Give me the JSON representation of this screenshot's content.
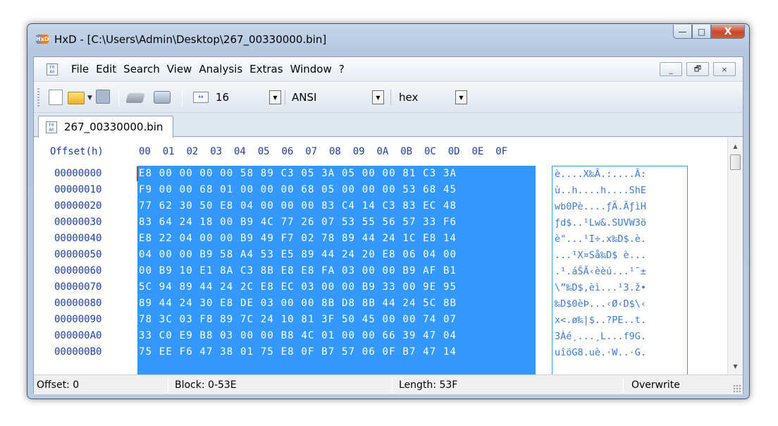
{
  "window": {
    "title": "HxD - [C:\\Users\\Admin\\Desktop\\267_00330000.bin]",
    "icon": "hxd-app-icon",
    "caption_buttons": {
      "minimize": "—",
      "maximize": "□",
      "close": "X"
    }
  },
  "menubar": {
    "items": [
      "File",
      "Edit",
      "Search",
      "View",
      "Analysis",
      "Extras",
      "Window",
      "?"
    ],
    "mdi_buttons": {
      "minimize": "_",
      "restore": "🗗",
      "close": "×"
    }
  },
  "toolbar": {
    "bytes_per_row": "16",
    "charset": "ANSI",
    "offset_base": "hex",
    "icons": [
      "new-file-icon",
      "open-file-icon",
      "save-icon",
      "open-disk-icon",
      "open-ram-icon",
      "bytes-per-row-icon"
    ]
  },
  "tab": {
    "label": "267_00330000.bin"
  },
  "editor": {
    "offset_header": "Offset(h)",
    "columns": [
      "00",
      "01",
      "02",
      "03",
      "04",
      "05",
      "06",
      "07",
      "08",
      "09",
      "0A",
      "0B",
      "0C",
      "0D",
      "0E",
      "0F"
    ],
    "rows": [
      {
        "offset": "00000000",
        "hex": "E8 00 00 00 00 58 89 C3 05 3A 05 00 00 81 C3 3A",
        "ascii": "è....X‰Ã.:....Ã:"
      },
      {
        "offset": "00000010",
        "hex": "F9 00 00 68 01 00 00 00 68 05 00 00 00 53 68 45",
        "ascii": "ù..h....h....ShE"
      },
      {
        "offset": "00000020",
        "hex": "77 62 30 50 E8 04 00 00 00 83 C4 14 C3 83 EC 48",
        "ascii": "wb0Pè....ƒÄ.ÃƒìH"
      },
      {
        "offset": "00000030",
        "hex": "83 64 24 18 00 B9 4C 77 26 07 53 55 56 57 33 F6",
        "ascii": "ƒd$..¹Lw&.SUVW3ö"
      },
      {
        "offset": "00000040",
        "hex": "E8 22 04 00 00 B9 49 F7 02 78 89 44 24 1C E8 14",
        "ascii": "è\"...¹I÷.x‰D$.è."
      },
      {
        "offset": "00000050",
        "hex": "04 00 00 B9 58 A4 53 E5 89 44 24 20 E8 06 04 00",
        "ascii": "...¹X¤Så‰D$ è..."
      },
      {
        "offset": "00000060",
        "hex": "00 B9 10 E1 8A C3 8B E8 E8 FA 03 00 00 B9 AF B1",
        "ascii": ".¹.áŠÃ‹èèú...¹¯±"
      },
      {
        "offset": "00000070",
        "hex": "5C 94 89 44 24 2C E8 EC 03 00 00 B9 33 00 9E 95",
        "ascii": "\\”‰D$,èì...¹3.ž•"
      },
      {
        "offset": "00000080",
        "hex": "89 44 24 30 E8 DE 03 00 00 8B D8 8B 44 24 5C 8B",
        "ascii": "‰D$0èÞ...‹Ø‹D$\\‹"
      },
      {
        "offset": "00000090",
        "hex": "78 3C 03 F8 89 7C 24 10 81 3F 50 45 00 00 74 07",
        "ascii": "x<.ø‰|$..?PE..t."
      },
      {
        "offset": "000000A0",
        "hex": "33 C0 E9 B8 03 00 00 B8 4C 01 00 00 66 39 47 04",
        "ascii": "3Àé¸...¸L...f9G."
      },
      {
        "offset": "000000B0",
        "hex": "75 EE F6 47 38 01 75 E8 0F B7 57 06 0F B7 47 14",
        "ascii": "uîöG8.uè.·W..·G."
      }
    ]
  },
  "statusbar": {
    "offset": "Offset: 0",
    "block": "Block: 0-53E",
    "length": "Length: 53F",
    "mode": "Overwrite"
  }
}
